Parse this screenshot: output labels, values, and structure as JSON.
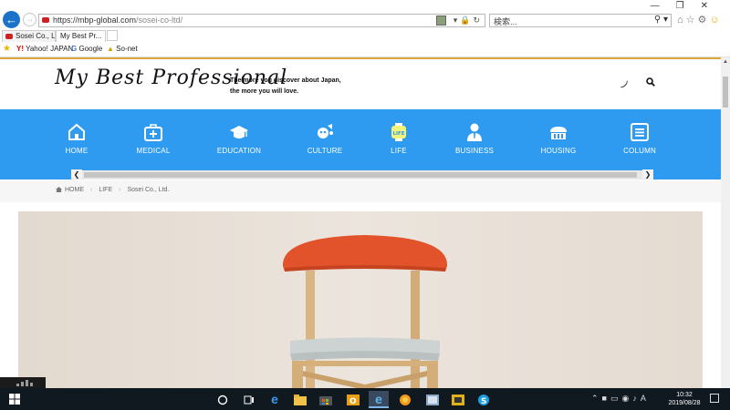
{
  "browser": {
    "url_domain": "https://mbp-global.com",
    "url_path": "/sosei-co-ltd/",
    "search_placeholder": "検索...",
    "tabs": [
      {
        "label": "Sosei Co., Ltd."
      },
      {
        "label": "My Best Pr..."
      }
    ],
    "favorites": [
      {
        "label": "Yahoo! JAPAN"
      },
      {
        "label": "Google"
      },
      {
        "label": "So-net"
      }
    ]
  },
  "site": {
    "logo": "My Best Professional",
    "tagline_line1": "The more you discover about Japan,",
    "tagline_line2": "the more you will love.",
    "nav": [
      {
        "label": "HOME",
        "icon": "home-icon"
      },
      {
        "label": "MEDICAL",
        "icon": "medical-kit-icon"
      },
      {
        "label": "EDUCATION",
        "icon": "graduation-cap-icon"
      },
      {
        "label": "CULTURE",
        "icon": "culture-icon"
      },
      {
        "label": "LIFE",
        "icon": "life-icon"
      },
      {
        "label": "BUSINESS",
        "icon": "business-person-icon"
      },
      {
        "label": "HOUSING",
        "icon": "housing-icon"
      },
      {
        "label": "COLUMN",
        "icon": "column-icon"
      }
    ],
    "breadcrumb": {
      "home": "HOME",
      "section": "LIFE",
      "current": "Sosei Co., Ltd."
    },
    "nav_color": "#2e9bf0",
    "accent_color": "#d8a63a",
    "chair_color": "#e2532b"
  },
  "taskbar": {
    "time": "10:32",
    "date": "2019/08/28"
  }
}
